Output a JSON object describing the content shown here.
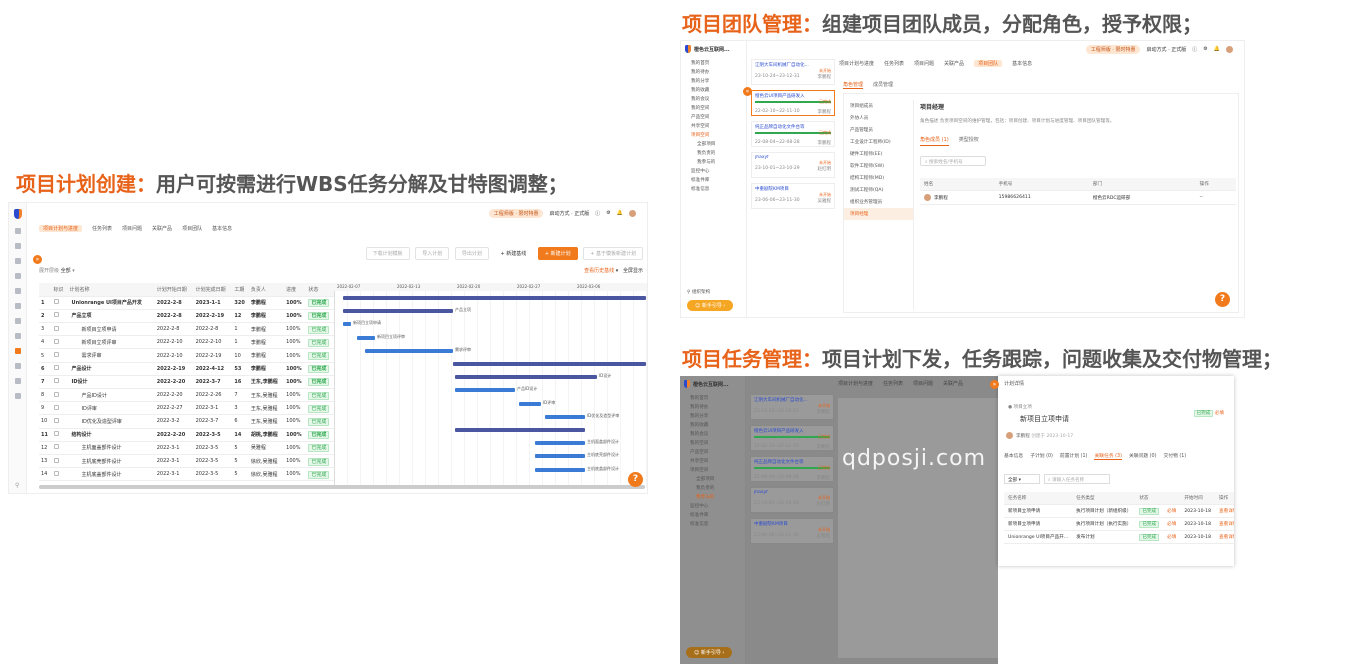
{
  "headings": {
    "plan": {
      "keyword": "项目计划创建：",
      "text": "用户可按需进行WBS任务分解及甘特图调整；"
    },
    "team": {
      "keyword": "项目团队管理：",
      "text": "组建项目团队成员，分配角色，授予权限；"
    },
    "task": {
      "keyword": "项目任务管理：",
      "text": "项目计划下发，任务跟踪，问题收集及交付物管理；"
    }
  },
  "common": {
    "edition_badge": "工程师版 · 限时特惠",
    "mode": "启动方式 · 正式版",
    "brand": "橙色云互联网...",
    "guide_btn": "新手引导",
    "notif_count": "99",
    "help": "?"
  },
  "plan": {
    "tabs": [
      "项目计划与进度",
      "任务列表",
      "项目问题",
      "关联产品",
      "项目团队",
      "基本信息"
    ],
    "toolbar": [
      "下载计划模板",
      "导入计划",
      "导出计划"
    ],
    "baseline_btn": "+ 新建基线",
    "new_plan_btn": "+ 新建计划",
    "upload_btn": "+ 基于模板新建计划",
    "filter_label": "展开层级",
    "filter_value": "全部",
    "history_link": "查看历史基线",
    "fullscreen": "全屏显示",
    "columns": [
      "",
      "标识",
      "计划名称",
      "计划开始日期",
      "计划完成日期",
      "工期",
      "负责人",
      "进度",
      "状态"
    ],
    "rows": [
      {
        "n": "1",
        "name": "Unionrange UI项目产品开发",
        "start": "2022-2-8",
        "end": "2023-1-1",
        "dur": "320",
        "owner": "李鹏程",
        "pct": "100%",
        "st": "已完成",
        "bold": true
      },
      {
        "n": "2",
        "name": "产品立项",
        "start": "2022-2-8",
        "end": "2022-2-19",
        "dur": "12",
        "owner": "李鹏程",
        "pct": "100%",
        "st": "已完成",
        "bold": true
      },
      {
        "n": "3",
        "name": "新项目立项申请",
        "start": "2022-2-8",
        "end": "2022-2-8",
        "dur": "1",
        "owner": "李鹏程",
        "pct": "100%",
        "st": "已完成",
        "bold": false
      },
      {
        "n": "4",
        "name": "新项目立项评审",
        "start": "2022-2-10",
        "end": "2022-2-10",
        "dur": "1",
        "owner": "李鹏程",
        "pct": "100%",
        "st": "已完成",
        "bold": false
      },
      {
        "n": "5",
        "name": "需求评审",
        "start": "2022-2-10",
        "end": "2022-2-19",
        "dur": "10",
        "owner": "李鹏程",
        "pct": "100%",
        "st": "已完成",
        "bold": false
      },
      {
        "n": "6",
        "name": "产品设计",
        "start": "2022-2-19",
        "end": "2022-4-12",
        "dur": "53",
        "owner": "李鹏程",
        "pct": "100%",
        "st": "已完成",
        "bold": true
      },
      {
        "n": "7",
        "name": "ID设计",
        "start": "2022-2-20",
        "end": "2022-3-7",
        "dur": "16",
        "owner": "王东,李鹏程",
        "pct": "100%",
        "st": "已完成",
        "bold": true
      },
      {
        "n": "8",
        "name": "产品ID设计",
        "start": "2022-2-20",
        "end": "2022-2-26",
        "dur": "7",
        "owner": "王东,吴雅程",
        "pct": "100%",
        "st": "已完成",
        "bold": false
      },
      {
        "n": "9",
        "name": "ID评审",
        "start": "2022-2-27",
        "end": "2022-3-1",
        "dur": "3",
        "owner": "王东,吴雅程",
        "pct": "100%",
        "st": "已完成",
        "bold": false
      },
      {
        "n": "10",
        "name": "ID优化及造型评审",
        "start": "2022-3-2",
        "end": "2022-3-7",
        "dur": "6",
        "owner": "王东,吴雅程",
        "pct": "100%",
        "st": "已完成",
        "bold": false
      },
      {
        "n": "11",
        "name": "结构设计",
        "start": "2022-2-20",
        "end": "2022-3-5",
        "dur": "14",
        "owner": "胡桃,李鹏程",
        "pct": "100%",
        "st": "已完成",
        "bold": true
      },
      {
        "n": "12",
        "name": "主机面盖部件设计",
        "start": "2022-3-1",
        "end": "2022-3-5",
        "dur": "5",
        "owner": "吴雅程",
        "pct": "100%",
        "st": "已完成",
        "bold": false
      },
      {
        "n": "13",
        "name": "主机底壳部件设计",
        "start": "2022-3-1",
        "end": "2022-3-5",
        "dur": "5",
        "owner": "徐欣,吴雅程",
        "pct": "100%",
        "st": "已完成",
        "bold": false
      },
      {
        "n": "14",
        "name": "主机底盖部件设计",
        "start": "2022-3-1",
        "end": "2022-3-5",
        "dur": "5",
        "owner": "徐欣,吴雅程",
        "pct": "100%",
        "st": "已完成",
        "bold": false
      }
    ],
    "gantt_dates": [
      "2022-02-07",
      "2022-02-13",
      "2022-02-20",
      "2022-02-27",
      "2022-03-06"
    ],
    "gantt_labels": [
      "产品立项",
      "新项目立项申请",
      "新项目立项评审",
      "需求评审",
      "ID设计",
      "产品ID设计",
      "ID评审",
      "ID优化及造型评审",
      "主机面盖部件设计",
      "主机底壳部件设计",
      "主机底盖部件设计"
    ]
  },
  "team": {
    "tabs": [
      "项目计划与进度",
      "任务列表",
      "项目问题",
      "关联产品",
      "项目团队",
      "基本信息"
    ],
    "sidebar": [
      "我的首页",
      "我的待办",
      "我的分享",
      "我的收藏",
      "我的会议",
      "我的空间",
      "产品空间",
      "共享空间",
      "项目空间",
      "全部项目",
      "我负责的",
      "我参与的",
      "监控中心",
      "标准件库",
      "标准信息"
    ],
    "projects": [
      {
        "t": "江阴大车间机械厂自动化...",
        "tag": "未开始",
        "date": "23-10-24~23-12-31",
        "who": "李鹏程"
      },
      {
        "t": "橙色云UI项目产品研发入",
        "tag": "已完成",
        "date": "22-02-10~22-11-10",
        "who": "李鹏程"
      },
      {
        "t": "纯正品牌自动化文件台等",
        "tag": "已完成",
        "date": "22-08-04~22-08-28",
        "who": "李鹏程"
      },
      {
        "t": "jhaxyf",
        "tag": "未开始",
        "date": "23-10-01~23-10-29",
        "who": "赵红明"
      },
      {
        "t": "中重剧院KM项目",
        "tag": "未开始",
        "date": "23-06-06~23-11-30",
        "who": "吴雅程"
      }
    ],
    "role_tabs": [
      "角色管理",
      "成员管理"
    ],
    "roles": [
      "项目组成员",
      "外协人员",
      "产品管理员",
      "工业设计工程师(ID)",
      "硬件工程师(EE)",
      "软件工程师(SW)",
      "结构工程师(MD)",
      "测试工程师(QA)",
      "组织业务管理员",
      "项目经理"
    ],
    "role_title": "项目经理",
    "role_desc": "角色描述  负责项目空间的维护管理，包括：项目创建、项目计划与进度管理、项目团队管理等。",
    "sub_tabs": [
      "角色成员 (1)",
      "类型授权"
    ],
    "search_ph": "搜索姓名/手机号",
    "member_cols": [
      "姓名",
      "手机号",
      "部门",
      "操作"
    ],
    "members": [
      {
        "name": "李鹏程",
        "phone": "15986626411",
        "dept": "橙色云RDC运研部",
        "op": "--"
      }
    ],
    "org_link": "组织架构"
  },
  "task": {
    "crumb": "项目立项",
    "title": "新项目立项申请",
    "status": "已完成",
    "mark": "必填",
    "creator": "李鹏程",
    "created": "创建于 2023-10-17",
    "tabs": [
      "基本信息",
      "子计划 (0)",
      "前置计划 (1)",
      "关联任务 (3)",
      "关联问题 (0)",
      "交付物 (1)"
    ],
    "filter": "全部",
    "search_ph": "请输入任务名称",
    "cols": [
      "任务名称",
      "任务类型",
      "状态",
      "",
      "开始时间",
      "操作"
    ],
    "rows": [
      {
        "name": "新项目立项申请",
        "type": "执行项目计划（新组织级）",
        "st": "已完成",
        "mk": "必填",
        "date": "2023-10-18",
        "op": "查看详情"
      },
      {
        "name": "新项目立项申请",
        "type": "执行项目计划（执行实施）",
        "st": "已完成",
        "mk": "必填",
        "date": "2023-10-18",
        "op": "查看详情"
      },
      {
        "name": "Unionrange UI项目产品开...",
        "type": "发布计划",
        "st": "已完成",
        "mk": "必填",
        "date": "2023-10-18",
        "op": "查看详情"
      }
    ],
    "window_title": "计划详情",
    "watermark": "qdposji.com"
  }
}
